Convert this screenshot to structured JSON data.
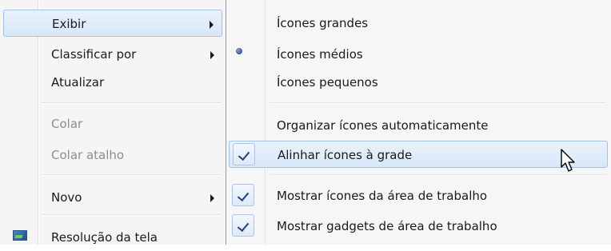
{
  "context_menu": {
    "items": [
      {
        "label": "Exibir",
        "submenu": true,
        "highlighted": true,
        "disabled": false
      },
      {
        "label": "Classificar por",
        "submenu": true,
        "disabled": false
      },
      {
        "label": "Atualizar",
        "disabled": false
      },
      {
        "label": "Colar",
        "disabled": true
      },
      {
        "label": "Colar atalho",
        "disabled": true
      },
      {
        "label": "Novo",
        "submenu": true,
        "disabled": false
      },
      {
        "label": "Resolução da tela",
        "icon": "screen-resolution-icon",
        "disabled": false
      }
    ]
  },
  "view_submenu": {
    "items": [
      {
        "label": "Ícones grandes",
        "state": "none"
      },
      {
        "label": "Ícones médios",
        "state": "radio-selected"
      },
      {
        "label": "Ícones pequenos",
        "state": "none"
      },
      {
        "label": "Organizar ícones automaticamente",
        "state": "none"
      },
      {
        "label": "Alinhar ícones à grade",
        "state": "checked",
        "highlighted": true
      },
      {
        "label": "Mostrar ícones da área de trabalho",
        "state": "checked"
      },
      {
        "label": "Mostrar gadgets de área de trabalho",
        "state": "checked"
      }
    ]
  },
  "colors": {
    "menu_background": "#f5f5f5",
    "highlight_border": "#9fc3ea",
    "highlight_fill": "#d7e7f8",
    "disabled_text": "#8d8d8d",
    "check_color": "#1f3f8a"
  }
}
